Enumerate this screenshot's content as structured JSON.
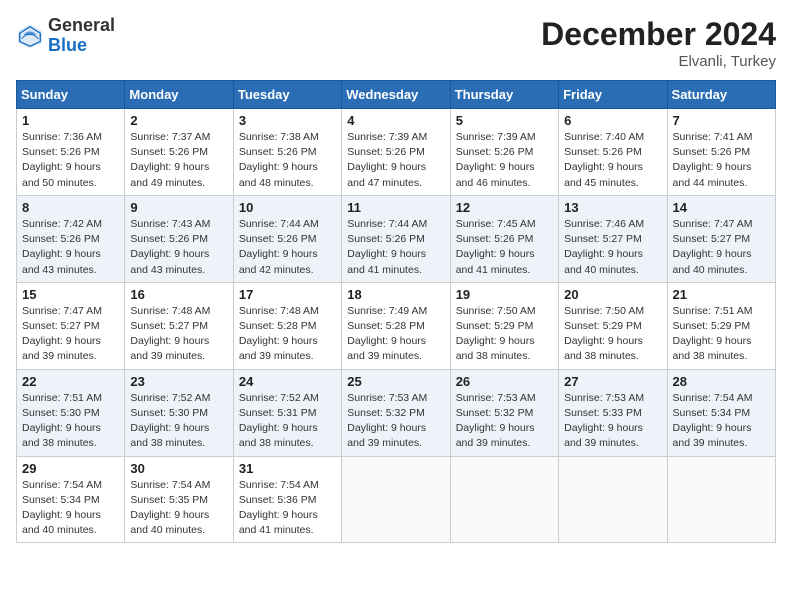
{
  "header": {
    "logo_general": "General",
    "logo_blue": "Blue",
    "month_title": "December 2024",
    "location": "Elvanli, Turkey"
  },
  "weekdays": [
    "Sunday",
    "Monday",
    "Tuesday",
    "Wednesday",
    "Thursday",
    "Friday",
    "Saturday"
  ],
  "weeks": [
    [
      {
        "day": "1",
        "sunrise": "7:36 AM",
        "sunset": "5:26 PM",
        "daylight": "9 hours and 50 minutes."
      },
      {
        "day": "2",
        "sunrise": "7:37 AM",
        "sunset": "5:26 PM",
        "daylight": "9 hours and 49 minutes."
      },
      {
        "day": "3",
        "sunrise": "7:38 AM",
        "sunset": "5:26 PM",
        "daylight": "9 hours and 48 minutes."
      },
      {
        "day": "4",
        "sunrise": "7:39 AM",
        "sunset": "5:26 PM",
        "daylight": "9 hours and 47 minutes."
      },
      {
        "day": "5",
        "sunrise": "7:39 AM",
        "sunset": "5:26 PM",
        "daylight": "9 hours and 46 minutes."
      },
      {
        "day": "6",
        "sunrise": "7:40 AM",
        "sunset": "5:26 PM",
        "daylight": "9 hours and 45 minutes."
      },
      {
        "day": "7",
        "sunrise": "7:41 AM",
        "sunset": "5:26 PM",
        "daylight": "9 hours and 44 minutes."
      }
    ],
    [
      {
        "day": "8",
        "sunrise": "7:42 AM",
        "sunset": "5:26 PM",
        "daylight": "9 hours and 43 minutes."
      },
      {
        "day": "9",
        "sunrise": "7:43 AM",
        "sunset": "5:26 PM",
        "daylight": "9 hours and 43 minutes."
      },
      {
        "day": "10",
        "sunrise": "7:44 AM",
        "sunset": "5:26 PM",
        "daylight": "9 hours and 42 minutes."
      },
      {
        "day": "11",
        "sunrise": "7:44 AM",
        "sunset": "5:26 PM",
        "daylight": "9 hours and 41 minutes."
      },
      {
        "day": "12",
        "sunrise": "7:45 AM",
        "sunset": "5:26 PM",
        "daylight": "9 hours and 41 minutes."
      },
      {
        "day": "13",
        "sunrise": "7:46 AM",
        "sunset": "5:27 PM",
        "daylight": "9 hours and 40 minutes."
      },
      {
        "day": "14",
        "sunrise": "7:47 AM",
        "sunset": "5:27 PM",
        "daylight": "9 hours and 40 minutes."
      }
    ],
    [
      {
        "day": "15",
        "sunrise": "7:47 AM",
        "sunset": "5:27 PM",
        "daylight": "9 hours and 39 minutes."
      },
      {
        "day": "16",
        "sunrise": "7:48 AM",
        "sunset": "5:27 PM",
        "daylight": "9 hours and 39 minutes."
      },
      {
        "day": "17",
        "sunrise": "7:48 AM",
        "sunset": "5:28 PM",
        "daylight": "9 hours and 39 minutes."
      },
      {
        "day": "18",
        "sunrise": "7:49 AM",
        "sunset": "5:28 PM",
        "daylight": "9 hours and 39 minutes."
      },
      {
        "day": "19",
        "sunrise": "7:50 AM",
        "sunset": "5:29 PM",
        "daylight": "9 hours and 38 minutes."
      },
      {
        "day": "20",
        "sunrise": "7:50 AM",
        "sunset": "5:29 PM",
        "daylight": "9 hours and 38 minutes."
      },
      {
        "day": "21",
        "sunrise": "7:51 AM",
        "sunset": "5:29 PM",
        "daylight": "9 hours and 38 minutes."
      }
    ],
    [
      {
        "day": "22",
        "sunrise": "7:51 AM",
        "sunset": "5:30 PM",
        "daylight": "9 hours and 38 minutes."
      },
      {
        "day": "23",
        "sunrise": "7:52 AM",
        "sunset": "5:30 PM",
        "daylight": "9 hours and 38 minutes."
      },
      {
        "day": "24",
        "sunrise": "7:52 AM",
        "sunset": "5:31 PM",
        "daylight": "9 hours and 38 minutes."
      },
      {
        "day": "25",
        "sunrise": "7:53 AM",
        "sunset": "5:32 PM",
        "daylight": "9 hours and 39 minutes."
      },
      {
        "day": "26",
        "sunrise": "7:53 AM",
        "sunset": "5:32 PM",
        "daylight": "9 hours and 39 minutes."
      },
      {
        "day": "27",
        "sunrise": "7:53 AM",
        "sunset": "5:33 PM",
        "daylight": "9 hours and 39 minutes."
      },
      {
        "day": "28",
        "sunrise": "7:54 AM",
        "sunset": "5:34 PM",
        "daylight": "9 hours and 39 minutes."
      }
    ],
    [
      {
        "day": "29",
        "sunrise": "7:54 AM",
        "sunset": "5:34 PM",
        "daylight": "9 hours and 40 minutes."
      },
      {
        "day": "30",
        "sunrise": "7:54 AM",
        "sunset": "5:35 PM",
        "daylight": "9 hours and 40 minutes."
      },
      {
        "day": "31",
        "sunrise": "7:54 AM",
        "sunset": "5:36 PM",
        "daylight": "9 hours and 41 minutes."
      },
      null,
      null,
      null,
      null
    ]
  ]
}
